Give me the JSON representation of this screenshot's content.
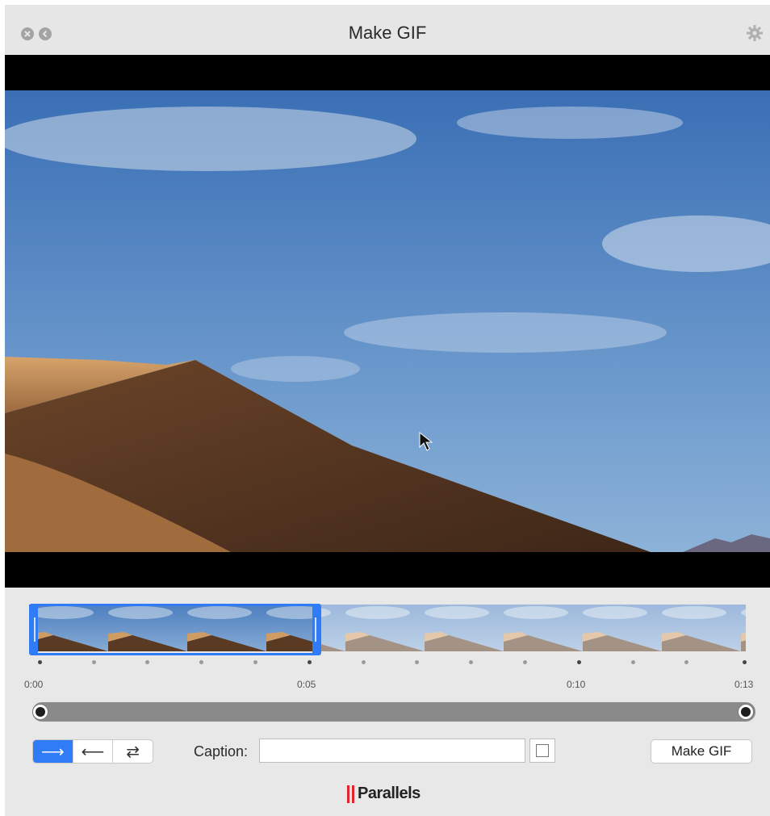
{
  "window": {
    "title": "Make GIF"
  },
  "icons": {
    "close": "close-icon",
    "back": "back-icon",
    "settings": "gear-icon",
    "cursor": "mouse-pointer-icon"
  },
  "timeline": {
    "labels": [
      "0:00",
      "0:05",
      "0:10",
      "0:13"
    ],
    "selection_end": "0:05"
  },
  "direction": {
    "forward": "⟶",
    "backward": "⟵",
    "bounce": "⇄",
    "selected": "forward"
  },
  "caption": {
    "label": "Caption:",
    "value": ""
  },
  "make_button": "Make GIF",
  "brand": {
    "name": "Parallels"
  },
  "colors": {
    "accent": "#2f7cf6",
    "brand": "#e0262b"
  }
}
